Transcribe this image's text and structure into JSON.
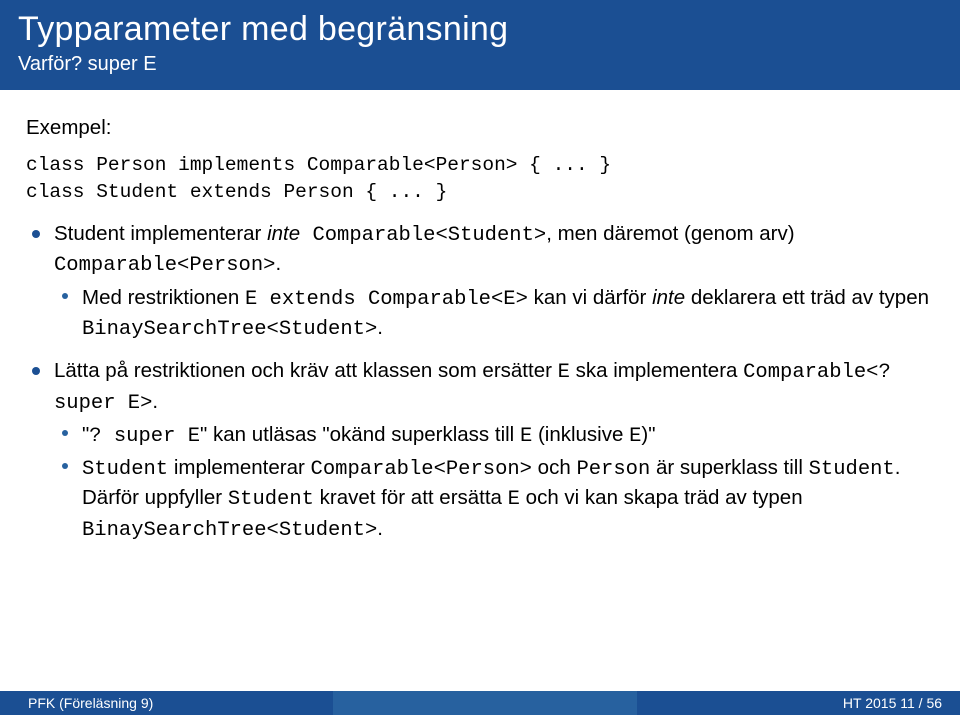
{
  "header": {
    "title": "Typparameter med begränsning",
    "subtitle": "Varför? super E"
  },
  "example_label": "Exempel:",
  "code": "class Person implements Comparable<Person> { ... }\nclass Student extends Person { ... }",
  "bul1": {
    "p1": "Student implementerar ",
    "p2": "inte",
    "p3": " Comparable<Student>",
    "p4": ", men däremot (genom arv) ",
    "p5": "Comparable<Person>",
    "p6": "."
  },
  "bul1a": {
    "p1": "Med restriktionen ",
    "p2": "E extends Comparable<E>",
    "p3": " kan vi därför ",
    "p4": "inte",
    "p5": " deklarera ett träd av typen ",
    "p6": "BinaySearchTree<Student>",
    "p7": "."
  },
  "bul2": {
    "p1": "Lätta på restriktionen och kräv att klassen som ersätter ",
    "p2": "E",
    "p3": " ska implementera ",
    "p4": "Comparable<? super E>",
    "p5": "."
  },
  "bul2a": {
    "p1": "\"",
    "p2": "? super E",
    "p3": "\" kan utläsas \"okänd superklass till ",
    "p4": "E",
    "p5": " (inklusive ",
    "p6": "E",
    "p7": ")\""
  },
  "bul2b": {
    "p1": "Student",
    "p2": " implementerar ",
    "p3": "Comparable<Person>",
    "p4": " och ",
    "p5": "Person",
    "p6": " är superklass till ",
    "p7": "Student",
    "p8": ". Därför uppfyller ",
    "p9": "Student",
    "p10": " kravet för att ersätta ",
    "p11": "E",
    "p12": " och vi kan skapa träd av typen ",
    "p13": "BinaySearchTree<Student>",
    "p14": "."
  },
  "footer": {
    "left": "PFK (Föreläsning 9)",
    "right": "HT 2015     11 / 56"
  }
}
